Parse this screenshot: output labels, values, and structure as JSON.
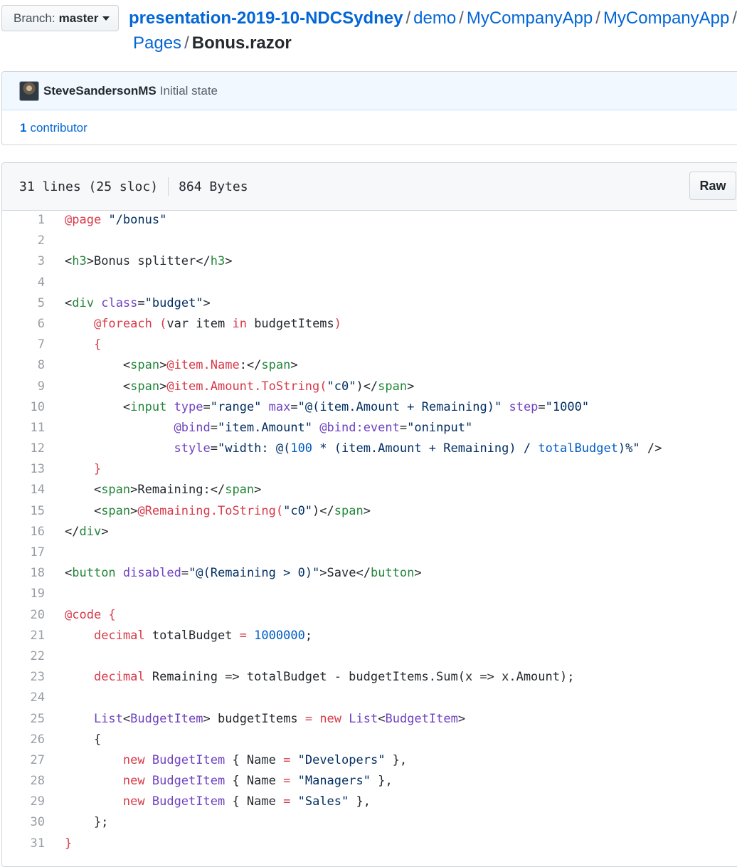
{
  "branch": {
    "label": "Branch:",
    "name": "master"
  },
  "breadcrumb": {
    "repo": "presentation-2019-10-NDCSydney",
    "parts": [
      "demo",
      "MyCompanyApp",
      "MyCompanyApp",
      "Pages"
    ],
    "separator": "/",
    "file": "Bonus.razor"
  },
  "commit": {
    "author": "SteveSandersonMS",
    "message": "Initial state"
  },
  "contributors": {
    "count": "1",
    "label": "contributor"
  },
  "file_info": {
    "lines": "31 lines (25 sloc)",
    "size": "864 Bytes",
    "raw_label": "Raw"
  },
  "colors": {
    "link": "#0366d6",
    "keyword": "#d73a49",
    "tag": "#22863a",
    "attr": "#6f42c1",
    "string": "#032f62",
    "constant": "#005cc5"
  },
  "code_lines": [
    [
      [
        "k",
        "@page"
      ],
      [
        "",
        " "
      ],
      [
        "s",
        "\"/bonus\""
      ]
    ],
    [],
    [
      [
        "",
        "<"
      ],
      [
        "t",
        "h3"
      ],
      [
        "",
        ">Bonus splitter</"
      ],
      [
        "t",
        "h3"
      ],
      [
        "",
        ">"
      ]
    ],
    [],
    [
      [
        "",
        "<"
      ],
      [
        "t",
        "div"
      ],
      [
        "",
        " "
      ],
      [
        "a",
        "class"
      ],
      [
        "",
        "="
      ],
      [
        "s",
        "\"budget\""
      ],
      [
        "",
        ">"
      ]
    ],
    [
      [
        "",
        "    "
      ],
      [
        "k",
        "@foreach"
      ],
      [
        "",
        " "
      ],
      [
        "k",
        "("
      ],
      [
        "",
        "var item "
      ],
      [
        "k",
        "in"
      ],
      [
        "",
        " budgetItems"
      ],
      [
        "k",
        ")"
      ]
    ],
    [
      [
        "",
        "    "
      ],
      [
        "k",
        "{"
      ]
    ],
    [
      [
        "",
        "        <"
      ],
      [
        "t",
        "span"
      ],
      [
        "",
        ">"
      ],
      [
        "k",
        "@item.Name"
      ],
      [
        "",
        ":</"
      ],
      [
        "t",
        "span"
      ],
      [
        "",
        ">"
      ]
    ],
    [
      [
        "",
        "        <"
      ],
      [
        "t",
        "span"
      ],
      [
        "",
        ">"
      ],
      [
        "k",
        "@item.Amount.ToString("
      ],
      [
        "s",
        "\"c0\""
      ],
      [
        "",
        ")</"
      ],
      [
        "t",
        "span"
      ],
      [
        "",
        ">"
      ]
    ],
    [
      [
        "",
        "        <"
      ],
      [
        "t",
        "input"
      ],
      [
        "",
        " "
      ],
      [
        "a",
        "type"
      ],
      [
        "",
        "="
      ],
      [
        "s",
        "\"range\""
      ],
      [
        "",
        " "
      ],
      [
        "a",
        "max"
      ],
      [
        "",
        "="
      ],
      [
        "s",
        "\"@(item.Amount + Remaining)\""
      ],
      [
        "",
        " "
      ],
      [
        "a",
        "step"
      ],
      [
        "",
        "="
      ],
      [
        "s",
        "\"1000\""
      ]
    ],
    [
      [
        "",
        "               "
      ],
      [
        "a",
        "@bind"
      ],
      [
        "",
        "="
      ],
      [
        "s",
        "\"item.Amount\""
      ],
      [
        "",
        " "
      ],
      [
        "a",
        "@bind:event"
      ],
      [
        "",
        "="
      ],
      [
        "s",
        "\"oninput\""
      ]
    ],
    [
      [
        "",
        "               "
      ],
      [
        "a",
        "style"
      ],
      [
        "",
        "="
      ],
      [
        "s",
        "\"width: @("
      ],
      [
        "c",
        "100"
      ],
      [
        "s",
        " * (item.Amount + Remaining) / "
      ],
      [
        "c",
        "totalBudget"
      ],
      [
        "s",
        ")%\""
      ],
      [
        "",
        " />"
      ]
    ],
    [
      [
        "",
        "    "
      ],
      [
        "k",
        "}"
      ]
    ],
    [
      [
        "",
        "    <"
      ],
      [
        "t",
        "span"
      ],
      [
        "",
        ">Remaining:</"
      ],
      [
        "t",
        "span"
      ],
      [
        "",
        ">"
      ]
    ],
    [
      [
        "",
        "    <"
      ],
      [
        "t",
        "span"
      ],
      [
        "",
        ">"
      ],
      [
        "k",
        "@Remaining.ToString("
      ],
      [
        "s",
        "\"c0\""
      ],
      [
        "",
        ")</"
      ],
      [
        "t",
        "span"
      ],
      [
        "",
        ">"
      ]
    ],
    [
      [
        "",
        "</"
      ],
      [
        "t",
        "div"
      ],
      [
        "",
        ">"
      ]
    ],
    [],
    [
      [
        "",
        "<"
      ],
      [
        "t",
        "button"
      ],
      [
        "",
        " "
      ],
      [
        "a",
        "disabled"
      ],
      [
        "",
        "="
      ],
      [
        "s",
        "\"@(Remaining > 0)\""
      ],
      [
        "",
        ">Save</"
      ],
      [
        "t",
        "button"
      ],
      [
        "",
        ">"
      ]
    ],
    [],
    [
      [
        "k",
        "@code {"
      ]
    ],
    [
      [
        "",
        "    "
      ],
      [
        "k",
        "decimal"
      ],
      [
        "",
        " totalBudget "
      ],
      [
        "k",
        "="
      ],
      [
        "",
        " "
      ],
      [
        "c",
        "1000000"
      ],
      [
        "",
        ";"
      ]
    ],
    [],
    [
      [
        "",
        "    "
      ],
      [
        "k",
        "decimal"
      ],
      [
        "",
        " Remaining => totalBudget - budgetItems.Sum(x => x.Amount);"
      ]
    ],
    [],
    [
      [
        "",
        "    "
      ],
      [
        "a",
        "List"
      ],
      [
        "",
        "<"
      ],
      [
        "a",
        "BudgetItem"
      ],
      [
        "",
        "> budgetItems "
      ],
      [
        "k",
        "="
      ],
      [
        "",
        " "
      ],
      [
        "k",
        "new"
      ],
      [
        "",
        " "
      ],
      [
        "a",
        "List"
      ],
      [
        "",
        "<"
      ],
      [
        "a",
        "BudgetItem"
      ],
      [
        "",
        ">"
      ]
    ],
    [
      [
        "",
        "    {"
      ]
    ],
    [
      [
        "",
        "        "
      ],
      [
        "k",
        "new"
      ],
      [
        "",
        " "
      ],
      [
        "a",
        "BudgetItem"
      ],
      [
        "",
        " { Name "
      ],
      [
        "k",
        "="
      ],
      [
        "",
        " "
      ],
      [
        "s",
        "\"Developers\""
      ],
      [
        "",
        " },"
      ]
    ],
    [
      [
        "",
        "        "
      ],
      [
        "k",
        "new"
      ],
      [
        "",
        " "
      ],
      [
        "a",
        "BudgetItem"
      ],
      [
        "",
        " { Name "
      ],
      [
        "k",
        "="
      ],
      [
        "",
        " "
      ],
      [
        "s",
        "\"Managers\""
      ],
      [
        "",
        " },"
      ]
    ],
    [
      [
        "",
        "        "
      ],
      [
        "k",
        "new"
      ],
      [
        "",
        " "
      ],
      [
        "a",
        "BudgetItem"
      ],
      [
        "",
        " { Name "
      ],
      [
        "k",
        "="
      ],
      [
        "",
        " "
      ],
      [
        "s",
        "\"Sales\""
      ],
      [
        "",
        " },"
      ]
    ],
    [
      [
        "",
        "    };"
      ]
    ],
    [
      [
        "k",
        "}"
      ]
    ]
  ]
}
